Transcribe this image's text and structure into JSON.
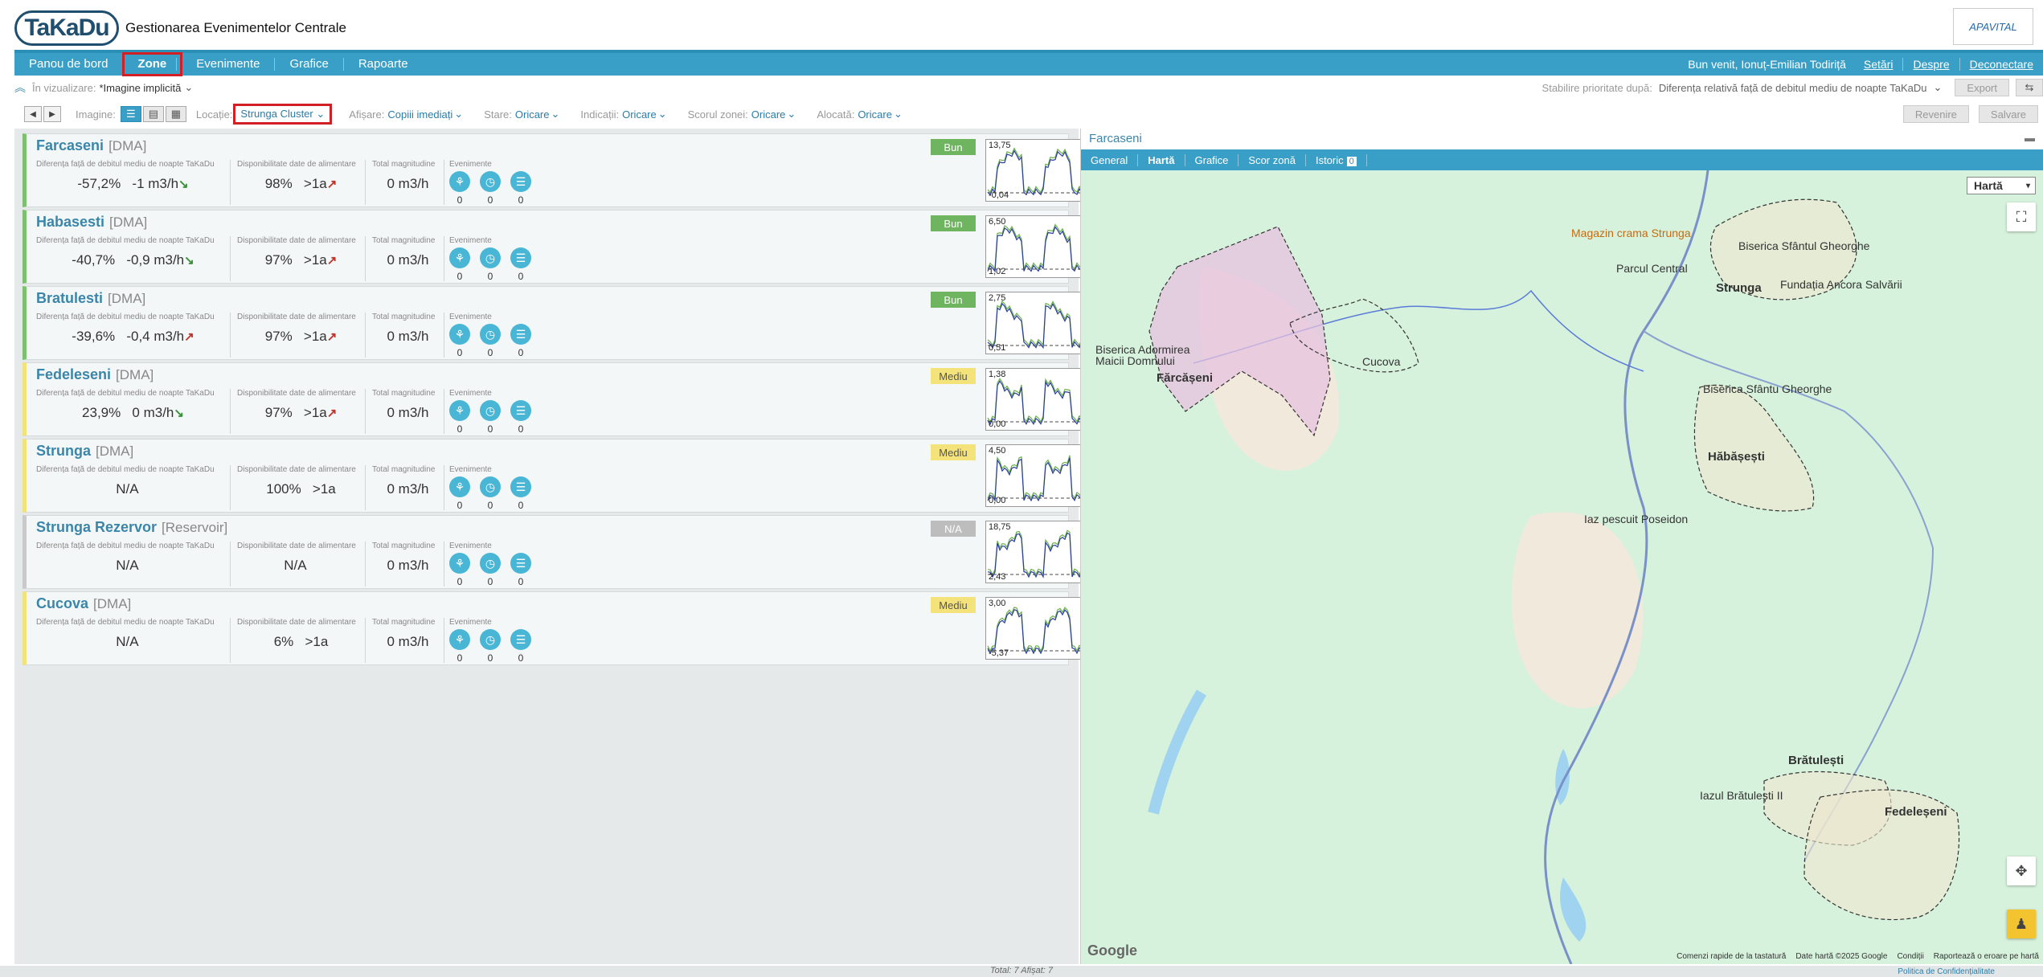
{
  "app": {
    "logo_text": "TaKaDu",
    "title": "Gestionarea Evenimentelor Centrale",
    "brand_logo": "APAVITAL"
  },
  "nav": {
    "items": [
      "Panou de bord",
      "Zone",
      "Evenimente",
      "Grafice",
      "Rapoarte"
    ],
    "active": "Zone",
    "welcome": "Bun venit, Ionuț-Emilian Todiriță",
    "links": [
      "Setări",
      "Despre",
      "Deconectare"
    ]
  },
  "viewbar": {
    "label": "În vizualizare:",
    "value": "*Imagine implicită",
    "priority_label": "Stabilire prioritate după:",
    "priority_value": "Diferența relativă față de debitul mediu de noapte TaKaDu",
    "export": "Export"
  },
  "filters": {
    "image_label": "Imagine:",
    "location_label": "Locație:",
    "location_value": "Strunga Cluster",
    "display_label": "Afișare:",
    "display_value": "Copiii imediați",
    "state_label": "Stare:",
    "state_value": "Oricare",
    "ind_label": "Indicații:",
    "ind_value": "Oricare",
    "score_label": "Scorul zonei:",
    "score_value": "Oricare",
    "alloc_label": "Alocată:",
    "alloc_value": "Oricare",
    "revert": "Revenire",
    "save": "Salvare"
  },
  "columns": {
    "c1": "Diferența față de debitul mediu de noapte TaKaDu",
    "c2": "Disponibilitate date de alimentare",
    "c3": "Total magnitudine",
    "c4": "Evenimente"
  },
  "zones": [
    {
      "name": "Farcaseni",
      "type": "[DMA]",
      "diff": "-57,2%",
      "flow": "-1 m3/h",
      "trend": "down",
      "avail": "98%",
      "avail2": ">1a",
      "avail_trend": "up",
      "magnitude": "0 m3/h",
      "events": [
        "0",
        "0",
        "0"
      ],
      "status": "Bun",
      "status_class": "bun",
      "hi": "13,75",
      "lo": "-0,04"
    },
    {
      "name": "Habasesti",
      "type": "[DMA]",
      "diff": "-40,7%",
      "flow": "-0,9 m3/h",
      "trend": "down",
      "avail": "97%",
      "avail2": ">1a",
      "avail_trend": "up",
      "magnitude": "0 m3/h",
      "events": [
        "0",
        "0",
        "0"
      ],
      "status": "Bun",
      "status_class": "bun",
      "hi": "6,50",
      "lo": "1,02"
    },
    {
      "name": "Bratulesti",
      "type": "[DMA]",
      "diff": "-39,6%",
      "flow": "-0,4 m3/h",
      "trend": "up",
      "avail": "97%",
      "avail2": ">1a",
      "avail_trend": "up",
      "magnitude": "0 m3/h",
      "events": [
        "0",
        "0",
        "0"
      ],
      "status": "Bun",
      "status_class": "bun",
      "hi": "2,75",
      "lo": "0,51"
    },
    {
      "name": "Fedeleseni",
      "type": "[DMA]",
      "diff": "23,9%",
      "flow": "0 m3/h",
      "trend": "down",
      "avail": "97%",
      "avail2": ">1a",
      "avail_trend": "up",
      "magnitude": "0 m3/h",
      "events": [
        "0",
        "0",
        "0"
      ],
      "status": "Mediu",
      "status_class": "mediu",
      "hi": "1,38",
      "lo": "0,00"
    },
    {
      "name": "Strunga",
      "type": "[DMA]",
      "diff": "N/A",
      "flow": "",
      "trend": "",
      "avail": "100%",
      "avail2": ">1a",
      "avail_trend": "",
      "magnitude": "0 m3/h",
      "events": [
        "0",
        "0",
        "0"
      ],
      "status": "Mediu",
      "status_class": "mediu",
      "hi": "4,50",
      "lo": "0,00"
    },
    {
      "name": "Strunga Rezervor",
      "type": "[Reservoir]",
      "diff": "N/A",
      "flow": "",
      "trend": "",
      "avail": "N/A",
      "avail2": "",
      "avail_trend": "",
      "magnitude": "0 m3/h",
      "events": [
        "0",
        "0",
        "0"
      ],
      "status": "N/A",
      "status_class": "na",
      "hi": "18,75",
      "lo": "2,43"
    },
    {
      "name": "Cucova",
      "type": "[DMA]",
      "diff": "N/A",
      "flow": "",
      "trend": "",
      "avail": "6%",
      "avail2": ">1a",
      "avail_trend": "",
      "magnitude": "0 m3/h",
      "events": [
        "0",
        "0",
        "0"
      ],
      "status": "Mediu",
      "status_class": "mediu",
      "hi": "3,00",
      "lo": "-5,37"
    }
  ],
  "footer": "Total: 7  Afișat: 7",
  "right_panel": {
    "title": "Farcaseni",
    "tabs": [
      "General",
      "Hartă",
      "Grafice",
      "Scor zonă",
      "Istoric"
    ],
    "active_tab": "Hartă",
    "history_count": "0",
    "map_type": "Hartă",
    "labels": {
      "farcaseni": "Fărcășeni",
      "cucova": "Cucova",
      "strunga": "Strunga",
      "habasesti": "Hăbășești",
      "bratulesti": "Brătulești",
      "fedeleseni": "Fedeleșeni",
      "magazin": "Magazin crama Strunga",
      "parcul": "Parcul Central",
      "biserica1": "Biserica Sfântul Gheorghe",
      "fundatia": "Fundația Ancora Salvării",
      "biserica2": "Biserica Sfântu Gheorghe",
      "biserica3": "Biserica Adormirea Maicii Domnului",
      "iaz1": "Iaz pescuit Poseidon",
      "iaz2": "Iazul Brătulești II"
    },
    "google": "Google",
    "attrib": [
      "Comenzi rapide de la tastatură",
      "Date hartă ©2025 Google",
      "Condiții",
      "Raportează o eroare pe hartă"
    ],
    "privacy": "Politica de Confidențialitate"
  }
}
